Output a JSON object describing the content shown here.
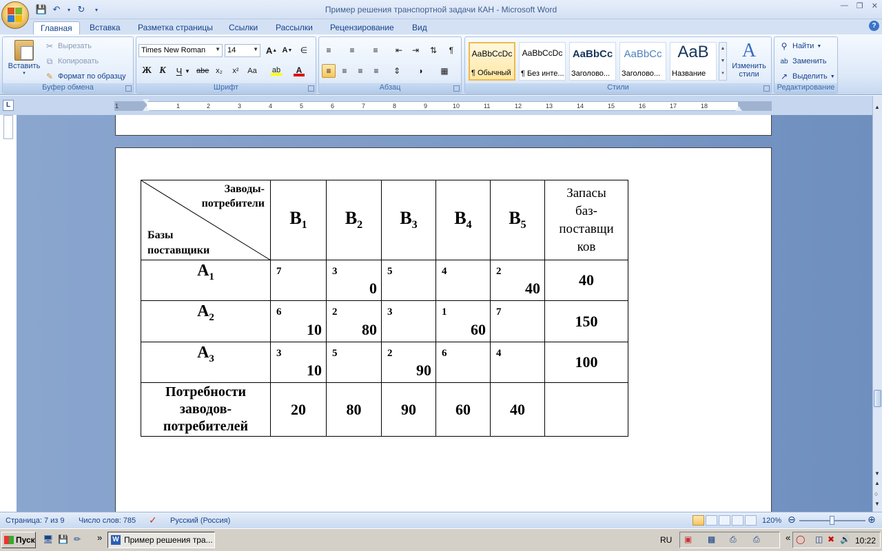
{
  "window": {
    "title": "Пример решения транспортной задачи КАН - Microsoft Word"
  },
  "tabs": [
    "Главная",
    "Вставка",
    "Разметка страницы",
    "Ссылки",
    "Рассылки",
    "Рецензирование",
    "Вид"
  ],
  "ribbon": {
    "clipboard": {
      "paste": "Вставить",
      "cut": "Вырезать",
      "copy": "Копировать",
      "format_painter": "Формат по образцу",
      "label": "Буфер обмена"
    },
    "font": {
      "name": "Times New Roman",
      "size": "14",
      "label": "Шрифт",
      "bold": "Ж",
      "italic": "К",
      "underline": "Ч",
      "strike": "abe",
      "subscript": "x₂",
      "superscript": "x²",
      "change_case": "Aa",
      "grow": "A",
      "shrink": "A"
    },
    "paragraph": {
      "label": "Абзац"
    },
    "styles": {
      "label": "Стили",
      "items": [
        {
          "sample": "AaBbCcDc",
          "name": "¶ Обычный"
        },
        {
          "sample": "AaBbCcDc",
          "name": "¶ Без инте..."
        },
        {
          "sample": "AaBbCc",
          "name": "Заголово..."
        },
        {
          "sample": "AaBbCc",
          "name": "Заголово..."
        },
        {
          "sample": "AaB",
          "name": "Название"
        }
      ],
      "change_styles_1": "Изменить",
      "change_styles_2": "стили"
    },
    "editing": {
      "label": "Редактирование",
      "find": "Найти",
      "replace": "Заменить",
      "select": "Выделить"
    }
  },
  "ruler": {
    "numbers": [
      "1",
      "1",
      "2",
      "3",
      "4",
      "5",
      "6",
      "7",
      "8",
      "9",
      "10",
      "11",
      "12",
      "13",
      "14",
      "15",
      "16",
      "17",
      "18"
    ]
  },
  "table": {
    "corner_top_1": "Заводы-",
    "corner_top_2": "потребители",
    "corner_bot_1": "Базы",
    "corner_bot_2": "поставщики",
    "consumers": [
      {
        "base": "B",
        "sub": "1"
      },
      {
        "base": "B",
        "sub": "2"
      },
      {
        "base": "B",
        "sub": "3"
      },
      {
        "base": "B",
        "sub": "4"
      },
      {
        "base": "B",
        "sub": "5"
      }
    ],
    "stock_header_lines": [
      "Запасы",
      "баз-",
      "поставщи",
      "ков"
    ],
    "rows": [
      {
        "base": "A",
        "sub": "1",
        "costs": [
          "7",
          "3",
          "5",
          "4",
          "2"
        ],
        "qty": [
          "",
          "0",
          "",
          "",
          "40"
        ],
        "stock": "40"
      },
      {
        "base": "A",
        "sub": "2",
        "costs": [
          "6",
          "2",
          "3",
          "1",
          "7"
        ],
        "qty": [
          "10",
          "80",
          "",
          "60",
          ""
        ],
        "stock": "150"
      },
      {
        "base": "A",
        "sub": "3",
        "costs": [
          "3",
          "5",
          "2",
          "6",
          "4"
        ],
        "qty": [
          "10",
          "",
          "90",
          "",
          ""
        ],
        "stock": "100"
      }
    ],
    "demand_lines": [
      "Потребности",
      "заводов-",
      "потребителей"
    ],
    "demand": [
      "20",
      "80",
      "90",
      "60",
      "40"
    ]
  },
  "status": {
    "page": "Страница: 7 из 9",
    "words": "Число слов: 785",
    "language": "Русский (Россия)",
    "zoom": "120%"
  },
  "taskbar": {
    "start": "Пуск",
    "task": "Пример решения тра...",
    "lang": "RU",
    "clock": "10:22"
  }
}
